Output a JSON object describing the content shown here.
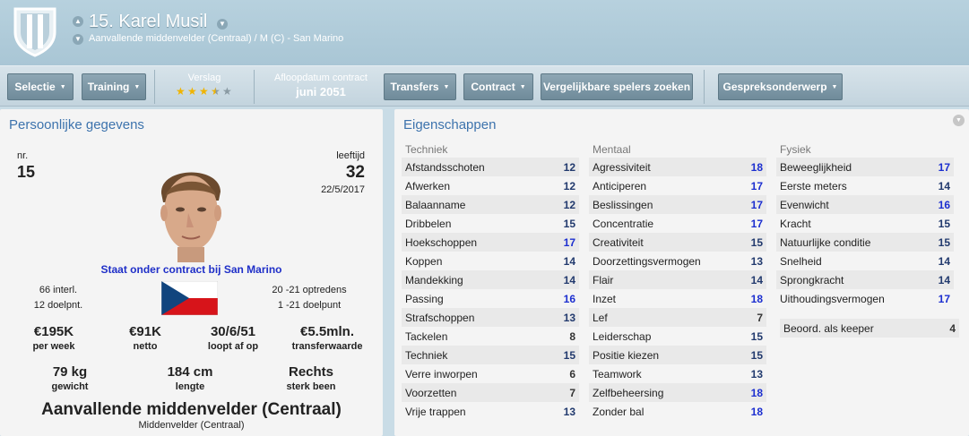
{
  "header": {
    "player_name": "15. Karel Musil",
    "subtitle": "Aanvallende middenvelder (Centraal) / M (C) - San Marino"
  },
  "toolbar": {
    "selectie": "Selectie",
    "training": "Training",
    "verslag_label": "Verslag",
    "verslag_stars": 3.5,
    "contract_end_label": "Afloopdatum contract",
    "contract_end_value": "juni 2051",
    "transfers": "Transfers",
    "contract": "Contract",
    "similar": "Vergelijkbare spelers zoeken",
    "topic": "Gespreksonderwerp"
  },
  "personal": {
    "title": "Persoonlijke gegevens",
    "nr_label": "nr.",
    "nr_value": "15",
    "age_label": "leeftijd",
    "age_value": "32",
    "birthdate": "22/5/2017",
    "contract_text": "Staat onder contract bij San Marino",
    "caps": "66 interl.",
    "goals": "12 doelpnt.",
    "u21_apps": "20 -21 optredens",
    "u21_goals": "1 -21 doelpunt",
    "wage_value": "€195K",
    "wage_label": "per week",
    "net_value": "€91K",
    "net_label": "netto",
    "expiry_value": "30/6/51",
    "expiry_label": "loopt af op",
    "transfer_value": "€5.5mln.",
    "transfer_label": "transferwaarde",
    "weight_value": "79 kg",
    "weight_label": "gewicht",
    "height_value": "184 cm",
    "height_label": "lengte",
    "foot_value": "Rechts",
    "foot_label": "sterk been",
    "position_main": "Aanvallende middenvelder (Centraal)",
    "position_sub": "Middenvelder (Centraal)"
  },
  "attributes": {
    "title": "Eigenschappen",
    "technique_head": "Techniek",
    "mental_head": "Mentaal",
    "physical_head": "Fysiek",
    "technique": [
      {
        "name": "Afstandsschoten",
        "value": "12"
      },
      {
        "name": "Afwerken",
        "value": "12"
      },
      {
        "name": "Balaanname",
        "value": "12"
      },
      {
        "name": "Dribbelen",
        "value": "15"
      },
      {
        "name": "Hoekschoppen",
        "value": "17"
      },
      {
        "name": "Koppen",
        "value": "14"
      },
      {
        "name": "Mandekking",
        "value": "14"
      },
      {
        "name": "Passing",
        "value": "16"
      },
      {
        "name": "Strafschoppen",
        "value": "13"
      },
      {
        "name": "Tackelen",
        "value": "8"
      },
      {
        "name": "Techniek",
        "value": "15"
      },
      {
        "name": "Verre inworpen",
        "value": "6"
      },
      {
        "name": "Voorzetten",
        "value": "7"
      },
      {
        "name": "Vrije trappen",
        "value": "13"
      }
    ],
    "mental": [
      {
        "name": "Agressiviteit",
        "value": "18"
      },
      {
        "name": "Anticiperen",
        "value": "17"
      },
      {
        "name": "Beslissingen",
        "value": "17"
      },
      {
        "name": "Concentratie",
        "value": "17"
      },
      {
        "name": "Creativiteit",
        "value": "15"
      },
      {
        "name": "Doorzettingsvermogen",
        "value": "13"
      },
      {
        "name": "Flair",
        "value": "14"
      },
      {
        "name": "Inzet",
        "value": "18"
      },
      {
        "name": "Lef",
        "value": "7"
      },
      {
        "name": "Leiderschap",
        "value": "15"
      },
      {
        "name": "Positie kiezen",
        "value": "15"
      },
      {
        "name": "Teamwork",
        "value": "13"
      },
      {
        "name": "Zelfbeheersing",
        "value": "18"
      },
      {
        "name": "Zonder bal",
        "value": "18"
      }
    ],
    "physical": [
      {
        "name": "Beweeglijkheid",
        "value": "17"
      },
      {
        "name": "Eerste meters",
        "value": "14"
      },
      {
        "name": "Evenwicht",
        "value": "16"
      },
      {
        "name": "Kracht",
        "value": "15"
      },
      {
        "name": "Natuurlijke conditie",
        "value": "15"
      },
      {
        "name": "Snelheid",
        "value": "14"
      },
      {
        "name": "Sprongkracht",
        "value": "14"
      },
      {
        "name": "Uithoudingsvermogen",
        "value": "17"
      }
    ],
    "keeper_label": "Beoord. als keeper",
    "keeper_value": "4"
  }
}
